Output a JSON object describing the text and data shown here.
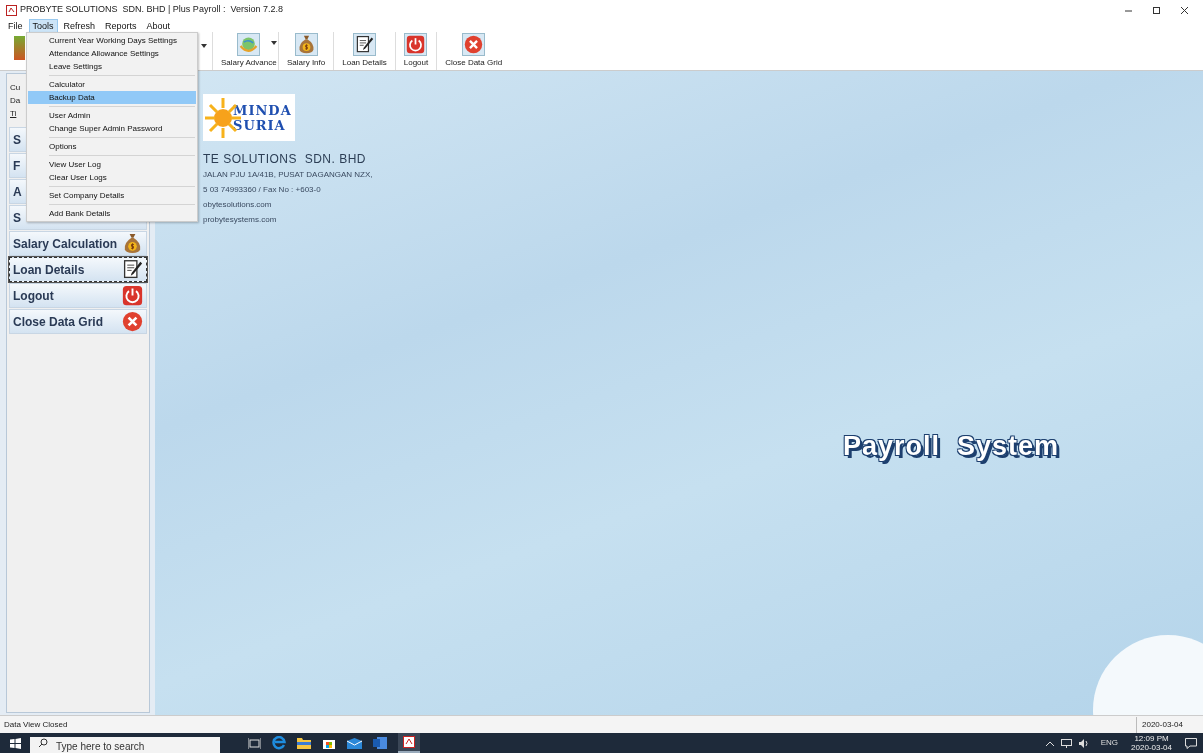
{
  "window": {
    "title": "PROBYTE SOLUTIONS  SDN. BHD | Plus Payroll :  Version 7.2.8"
  },
  "menu_bar": [
    {
      "label": "File",
      "selected": false
    },
    {
      "label": "Tools",
      "selected": true
    },
    {
      "label": "Refresh",
      "selected": false
    },
    {
      "label": "Reports",
      "selected": false
    },
    {
      "label": "About",
      "selected": false
    }
  ],
  "toolbar": [
    {
      "label": "Salary Advance",
      "kind": "globe",
      "dropdown": true
    },
    {
      "label": "Salary Info",
      "kind": "money",
      "dropdown": false
    },
    {
      "label": "Loan Details",
      "kind": "loan",
      "dropdown": false
    },
    {
      "label": "Logout",
      "kind": "logout",
      "dropdown": false
    },
    {
      "label": "Close Data Grid",
      "kind": "close",
      "dropdown": false
    }
  ],
  "tools_menu": [
    [
      {
        "label": "Current Year Working Days Settings",
        "selected": false
      },
      {
        "label": "Attendance Allowance Settings",
        "selected": false
      },
      {
        "label": "Leave Settings",
        "selected": false
      }
    ],
    [
      {
        "label": "Calculator",
        "selected": false
      },
      {
        "label": "Backup Data",
        "selected": true
      }
    ],
    [
      {
        "label": "User Admin",
        "selected": false
      },
      {
        "label": "Change Super Admin Password",
        "selected": false
      }
    ],
    [
      {
        "label": "Options",
        "selected": false
      }
    ],
    [
      {
        "label": "View User Log",
        "selected": false
      },
      {
        "label": "Clear User Logs",
        "selected": false
      }
    ],
    [
      {
        "label": "Set Company Details",
        "selected": false
      }
    ],
    [
      {
        "label": "Add Bank Details",
        "selected": false
      }
    ]
  ],
  "info_labels": [
    "Cu",
    "Da",
    "Ti"
  ],
  "sidebar": {
    "items": [
      {
        "label": "S",
        "kind": "hidden",
        "selected": false
      },
      {
        "label": "F",
        "kind": "hidden",
        "selected": false
      },
      {
        "label": "A",
        "kind": "hidden",
        "selected": false
      },
      {
        "label": "S",
        "kind": "hidden",
        "selected": false
      },
      {
        "label": "Salary Calculation",
        "kind": "money",
        "selected": false
      },
      {
        "label": "Loan Details",
        "kind": "loan",
        "selected": true
      },
      {
        "label": "Logout",
        "kind": "logout",
        "selected": false
      },
      {
        "label": "Close Data Grid",
        "kind": "close",
        "selected": false
      }
    ]
  },
  "logo": {
    "lines": [
      "MINDA",
      "SURIA"
    ]
  },
  "company": {
    "name": "TE SOLUTIONS  SDN. BHD",
    "lines": [
      "JALAN PJU 1A/41B, PUSAT DAGANGAN NZX,",
      "5 03 74993360 / Fax No : +603-0",
      "obytesolutions.com",
      "probytesystems.com"
    ]
  },
  "banner": "Payroll  System",
  "status_bar": {
    "message": "Data View Closed",
    "date": "2020-03-04"
  },
  "taskbar": {
    "search_placeholder": "Type here to search",
    "language": "ENG",
    "time": "12:09 PM",
    "date": "2020-03-04"
  }
}
